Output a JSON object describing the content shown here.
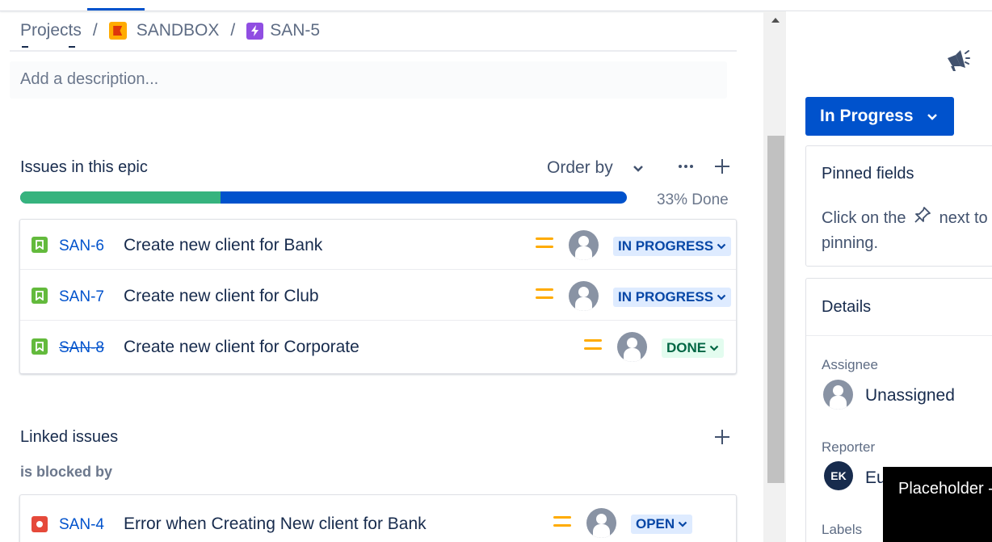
{
  "breadcrumb": {
    "projects": "Projects",
    "separator": "/",
    "project": "SANDBOX",
    "issue": "SAN-5"
  },
  "description": {
    "placeholder": "Add a description..."
  },
  "epic": {
    "heading": "Issues in this epic",
    "order_by": "Order by",
    "progress_percent": 33,
    "progress_label": "33% Done",
    "issues": [
      {
        "key": "SAN-6",
        "summary": "Create new client for Bank",
        "status": "IN PROGRESS",
        "priority": "medium",
        "done": false
      },
      {
        "key": "SAN-7",
        "summary": "Create new client for Club",
        "status": "IN PROGRESS",
        "priority": "medium",
        "done": false
      },
      {
        "key": "SAN-8",
        "summary": "Create new client for Corporate",
        "status": "DONE",
        "priority": "medium",
        "done": true
      }
    ]
  },
  "linked": {
    "heading": "Linked issues",
    "relation": "is blocked by",
    "issues": [
      {
        "key": "SAN-4",
        "summary": "Error when Creating New client for Bank",
        "status": "OPEN",
        "priority": "medium"
      }
    ]
  },
  "sidebar": {
    "status_button": "In Progress",
    "pinned": {
      "title": "Pinned fields",
      "text_before": "Click on the",
      "text_after": "next to",
      "text_line2": "pinning."
    },
    "details": {
      "title": "Details",
      "assignee_label": "Assignee",
      "assignee_value": "Unassigned",
      "reporter_label": "Reporter",
      "reporter_initials": "EK",
      "reporter_value": "Eu",
      "labels_label": "Labels"
    }
  },
  "tooltip": {
    "text": "Placeholder -"
  },
  "colors": {
    "primary": "#0052cc",
    "done_green": "#36b37e",
    "priority_medium": "#ffab00",
    "story": "#63ba3c",
    "bug": "#e5493a",
    "epic": "#904ee2"
  },
  "icons": {
    "project": "flag-icon",
    "epic": "lightning-icon",
    "story": "bookmark-icon",
    "bug": "bug-icon",
    "announce": "megaphone-icon",
    "pin": "pin-icon"
  }
}
